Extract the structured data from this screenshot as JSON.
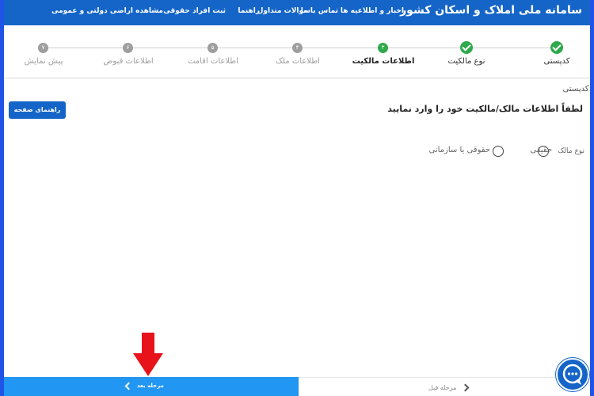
{
  "header": {
    "title": "سامانه ملی املاک و اسکان کشور",
    "nav": [
      "اخبار و اطلاعیه ها",
      "تماس با ما",
      "سوالات متداول",
      "راهنما",
      "ثبت افراد حقوقی",
      "مشاهده اراضی دولتی و عمومی"
    ]
  },
  "stepper": {
    "steps": [
      {
        "label": "کدپستی",
        "status": "done"
      },
      {
        "label": "نوع مالکیت",
        "status": "done"
      },
      {
        "label": "اطلاعات مالکیت",
        "status": "current",
        "number": "۳"
      },
      {
        "label": "اطلاعات ملک",
        "status": "pending",
        "number": "۴"
      },
      {
        "label": "اطلاعات اقامت",
        "status": "pending",
        "number": "۵"
      },
      {
        "label": "اطلاعات قبوض",
        "status": "pending",
        "number": "۶"
      },
      {
        "label": "پیش نمایش",
        "status": "pending",
        "number": "۷"
      }
    ]
  },
  "content": {
    "postal_label": "کدپستی:",
    "help_button": "راهنمای صفحه",
    "prompt": "لطفاً اطلاعات مالک/مالکیت خود را وارد نمایید",
    "owner_type_label": "نوع مالک",
    "options": [
      "حقیقی",
      "حقوقی یا سازمانی"
    ]
  },
  "footer": {
    "next": "مرحله بعد",
    "prev": "مرحله قبل"
  },
  "colors": {
    "primary": "#1565c8",
    "success": "#2ea94c",
    "next_button": "#2196f3",
    "arrow": "#e8121b"
  },
  "icons": [
    "check-icon",
    "chevron-left-icon",
    "chevron-right-icon",
    "down-arrow-icon",
    "chat-icon"
  ]
}
